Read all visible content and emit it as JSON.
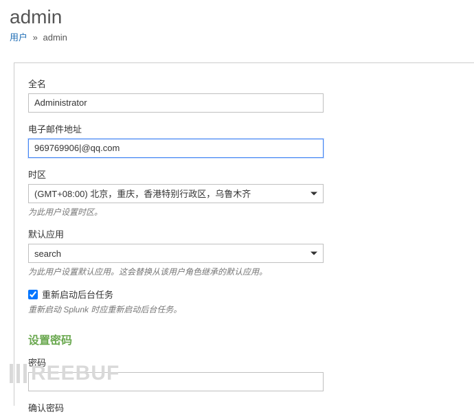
{
  "header": {
    "title": "admin"
  },
  "breadcrumb": {
    "root": "用户",
    "current": "admin"
  },
  "form": {
    "fullname": {
      "label": "全名",
      "value": "Administrator"
    },
    "email": {
      "label": "电子邮件地址",
      "value": "969769906|@qq.com"
    },
    "timezone": {
      "label": "时区",
      "value": "(GMT+08:00) 北京，重庆，香港特别行政区，乌鲁木齐",
      "help": "为此用户设置时区。"
    },
    "default_app": {
      "label": "默认应用",
      "value": "search",
      "help": "为此用户设置默认应用。这会替换从该用户角色继承的默认应用。"
    },
    "restart_bg": {
      "label": "重新启动后台任务",
      "help": "重新启动 Splunk 时应重新启动后台任务。",
      "checked": true
    },
    "password_section": {
      "title": "设置密码",
      "password_label": "密码",
      "confirm_label": "确认密码"
    }
  },
  "watermark": "REEBUF"
}
